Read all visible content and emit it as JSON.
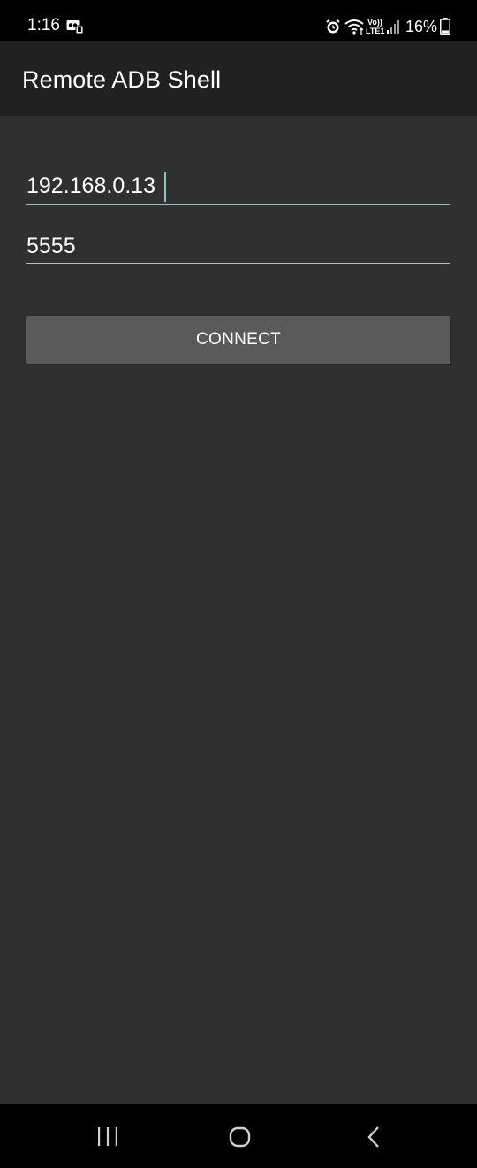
{
  "status_bar": {
    "time": "1:16",
    "battery_percent": "16%",
    "network_label_top": "Vo))",
    "network_label_bottom": "LTE1",
    "icons": [
      "notification-icon",
      "alarm-icon",
      "wifi-icon",
      "volte-icon",
      "signal-icon",
      "battery-icon"
    ]
  },
  "app_bar": {
    "title": "Remote ADB Shell"
  },
  "form": {
    "ip_value": "192.168.0.13",
    "port_value": "5555",
    "connect_label": "CONNECT"
  },
  "nav_bar": {
    "icons": [
      "recent-apps-icon",
      "home-icon",
      "back-icon"
    ]
  },
  "colors": {
    "background": "#303030",
    "app_bar": "#212121",
    "accent": "#80cbc4",
    "button": "#5a5a5a"
  }
}
